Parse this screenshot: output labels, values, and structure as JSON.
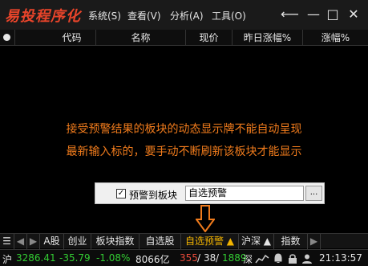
{
  "app": {
    "logo": "易投程序化"
  },
  "menu": [
    "系统(S)",
    "查看(V)",
    "分析(A)",
    "工具(O)"
  ],
  "window_controls": {
    "back": "⟵",
    "minimize": "—",
    "maximize": "□",
    "close": "✕"
  },
  "columns": [
    "代码",
    "名称",
    "现价",
    "昨日涨幅%",
    "涨幅%"
  ],
  "message": {
    "line1": "接受预警结果的板块的动态显示牌不能自动呈现",
    "line2": "最新输入标的，要手动不断刷新该板块才能显示"
  },
  "warning_box": {
    "checkbox_label": "预警到板块",
    "checked": true,
    "field_value": "自选预警",
    "button_label": "..."
  },
  "tabs": [
    {
      "label": "A股"
    },
    {
      "label": "创业"
    },
    {
      "label": "板块指数"
    },
    {
      "label": "自选股"
    },
    {
      "label": "自选预警 ▲"
    },
    {
      "label": "沪深 ▲"
    },
    {
      "label": "指数"
    }
  ],
  "status": {
    "market": "沪",
    "index": "3286.41",
    "change": "-35.79",
    "pct": "-1.08%",
    "volume": "8066亿",
    "up": "355",
    "flat": "38",
    "down": "1889",
    "market2": "深",
    "time": "21:13:57"
  },
  "colors": {
    "accent": "#f07b1c",
    "up": "#e84a3a",
    "down": "#33cc33",
    "active_tab": "#f3b400"
  }
}
